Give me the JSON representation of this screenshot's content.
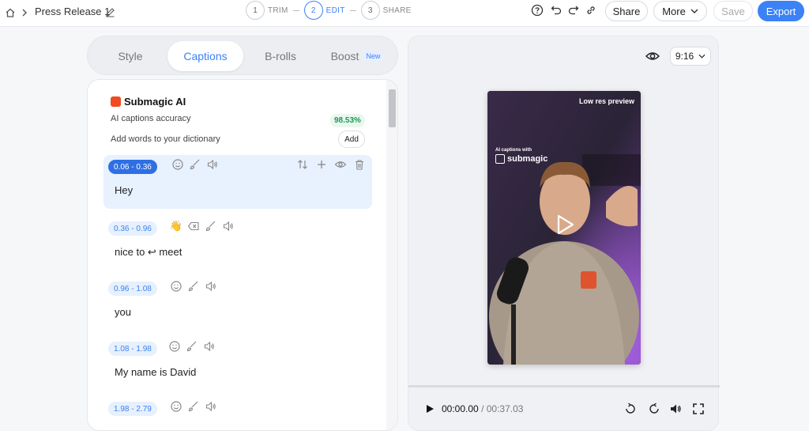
{
  "header": {
    "project_title": "Press Release 1",
    "steps": [
      {
        "num": "1",
        "label": "TRIM"
      },
      {
        "num": "2",
        "label": "EDIT"
      },
      {
        "num": "3",
        "label": "SHARE"
      }
    ],
    "share_label": "Share",
    "more_label": "More",
    "save_label": "Save",
    "export_label": "Export"
  },
  "tabs": [
    "Style",
    "Captions",
    "B-rolls",
    "Boost"
  ],
  "boost_badge": "New",
  "submagic": {
    "title": "Submagic AI",
    "accuracy_label": "AI captions accuracy",
    "accuracy_value": "98.53%",
    "dictionary_label": "Add words to your dictionary",
    "add_label": "Add"
  },
  "captions": [
    {
      "start": "0.06",
      "end": "0.36",
      "text": "Hey"
    },
    {
      "start": "0.36",
      "end": "0.96",
      "text": "nice to ↩ meet"
    },
    {
      "start": "0.96",
      "end": "1.08",
      "text": "you"
    },
    {
      "start": "1.08",
      "end": "1.98",
      "text": "My name is David"
    },
    {
      "start": "1.98",
      "end": "2.79",
      "text": ""
    }
  ],
  "preview": {
    "ratio": "9:16",
    "low_res_label": "Low res preview",
    "captions_with": "AI captions with",
    "brand": "submagic",
    "current_time": "00:00.00",
    "total_time": "/ 00:37.03"
  },
  "colors": {
    "accent": "#3b82f6",
    "success": "#1a9a55",
    "brand": "#f04a22"
  }
}
